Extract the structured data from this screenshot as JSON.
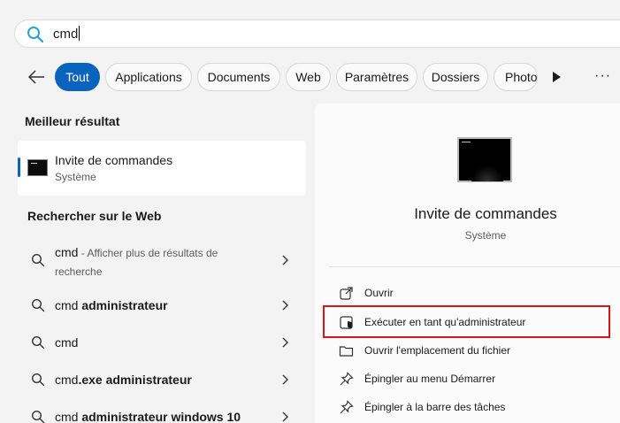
{
  "search": {
    "query": "cmd"
  },
  "filters": {
    "chips": [
      "Tout",
      "Applications",
      "Documents",
      "Web",
      "Paramètres",
      "Dossiers",
      "Photos"
    ],
    "active": "Tout"
  },
  "best_match": {
    "section_title": "Meilleur résultat",
    "app_name": "Invite de commandes",
    "app_type": "Système"
  },
  "web": {
    "section_title": "Rechercher sur le Web",
    "items": [
      {
        "prefix": "cmd",
        "bold": "",
        "muted": " - Afficher plus de résultats de",
        "line2": "recherche"
      },
      {
        "prefix": "cmd ",
        "bold": "administrateur",
        "muted": "",
        "line2": ""
      },
      {
        "prefix": "cmd",
        "bold": "",
        "muted": "",
        "line2": ""
      },
      {
        "prefix": "cmd",
        "bold": ".exe administrateur",
        "muted": "",
        "line2": ""
      },
      {
        "prefix": "cmd ",
        "bold": "administrateur windows 10",
        "muted": "",
        "line2": ""
      }
    ]
  },
  "details": {
    "title": "Invite de commandes",
    "subtitle": "Système",
    "actions": [
      {
        "label": "Ouvrir",
        "icon": "open-icon"
      },
      {
        "label": "Exécuter en tant qu'administrateur",
        "icon": "shield-icon"
      },
      {
        "label": "Ouvrir l'emplacement du fichier",
        "icon": "folder-icon"
      },
      {
        "label": "Épingler au menu Démarrer",
        "icon": "pin-icon"
      },
      {
        "label": "Épingler à la barre des tâches",
        "icon": "pin-icon"
      }
    ]
  },
  "colors": {
    "accent": "#0a63bd",
    "highlight": "#d7161c",
    "search_icon": "#2b9fd8"
  }
}
